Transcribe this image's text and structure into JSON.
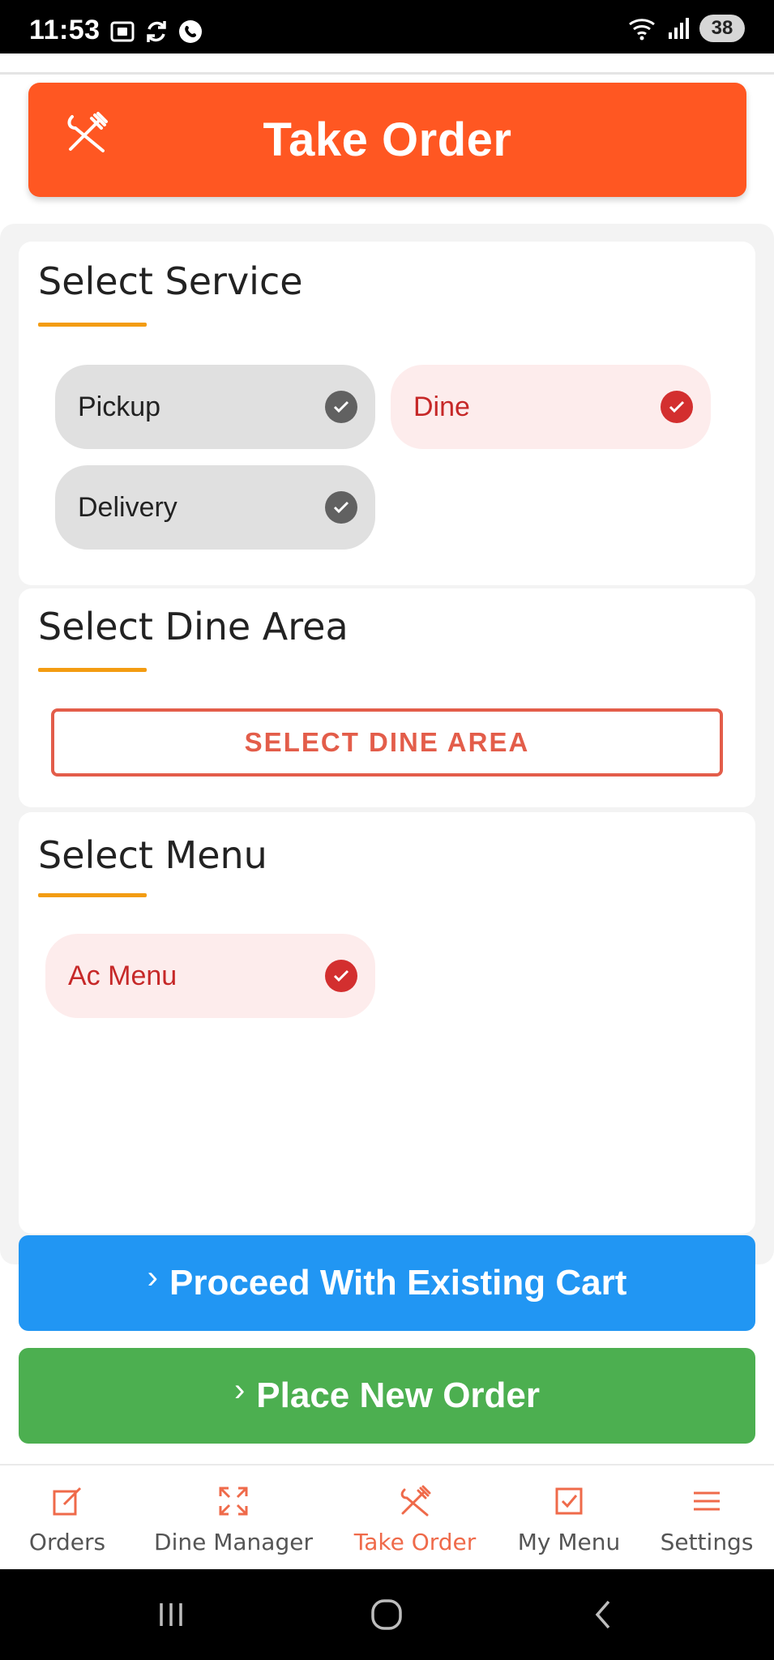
{
  "status_bar": {
    "time": "11:53",
    "battery": "38",
    "left_icons": [
      "screenshot-icon",
      "sync-icon",
      "whatsapp-icon"
    ],
    "right_icons": [
      "wifi-6e-icon",
      "signal-icon",
      "battery-icon"
    ]
  },
  "header": {
    "title": "Take Order",
    "icon": "utensils-icon",
    "color": "#ff5722"
  },
  "select_service": {
    "title": "Select Service",
    "options": [
      {
        "label": "Pickup",
        "selected": false
      },
      {
        "label": "Dine",
        "selected": true
      },
      {
        "label": "Delivery",
        "selected": false
      }
    ]
  },
  "select_dine_area": {
    "title": "Select Dine Area",
    "button_label": "SELECT DINE AREA"
  },
  "select_menu": {
    "title": "Select Menu",
    "options": [
      {
        "label": "Ac Menu",
        "selected": true
      }
    ]
  },
  "actions": {
    "proceed_label": "Proceed With Existing Cart",
    "new_order_label": "Place New Order",
    "proceed_color": "#2196f3",
    "new_order_color": "#4caf50"
  },
  "bottom_nav": {
    "items": [
      {
        "label": "Orders",
        "icon": "edit-icon",
        "active": false
      },
      {
        "label": "Dine Manager",
        "icon": "expand-icon",
        "active": false
      },
      {
        "label": "Take Order",
        "icon": "utensils-icon",
        "active": true
      },
      {
        "label": "My Menu",
        "icon": "checkbox-icon",
        "active": false
      },
      {
        "label": "Settings",
        "icon": "menu-icon",
        "active": false
      }
    ],
    "active_color": "#ef6a4a"
  }
}
